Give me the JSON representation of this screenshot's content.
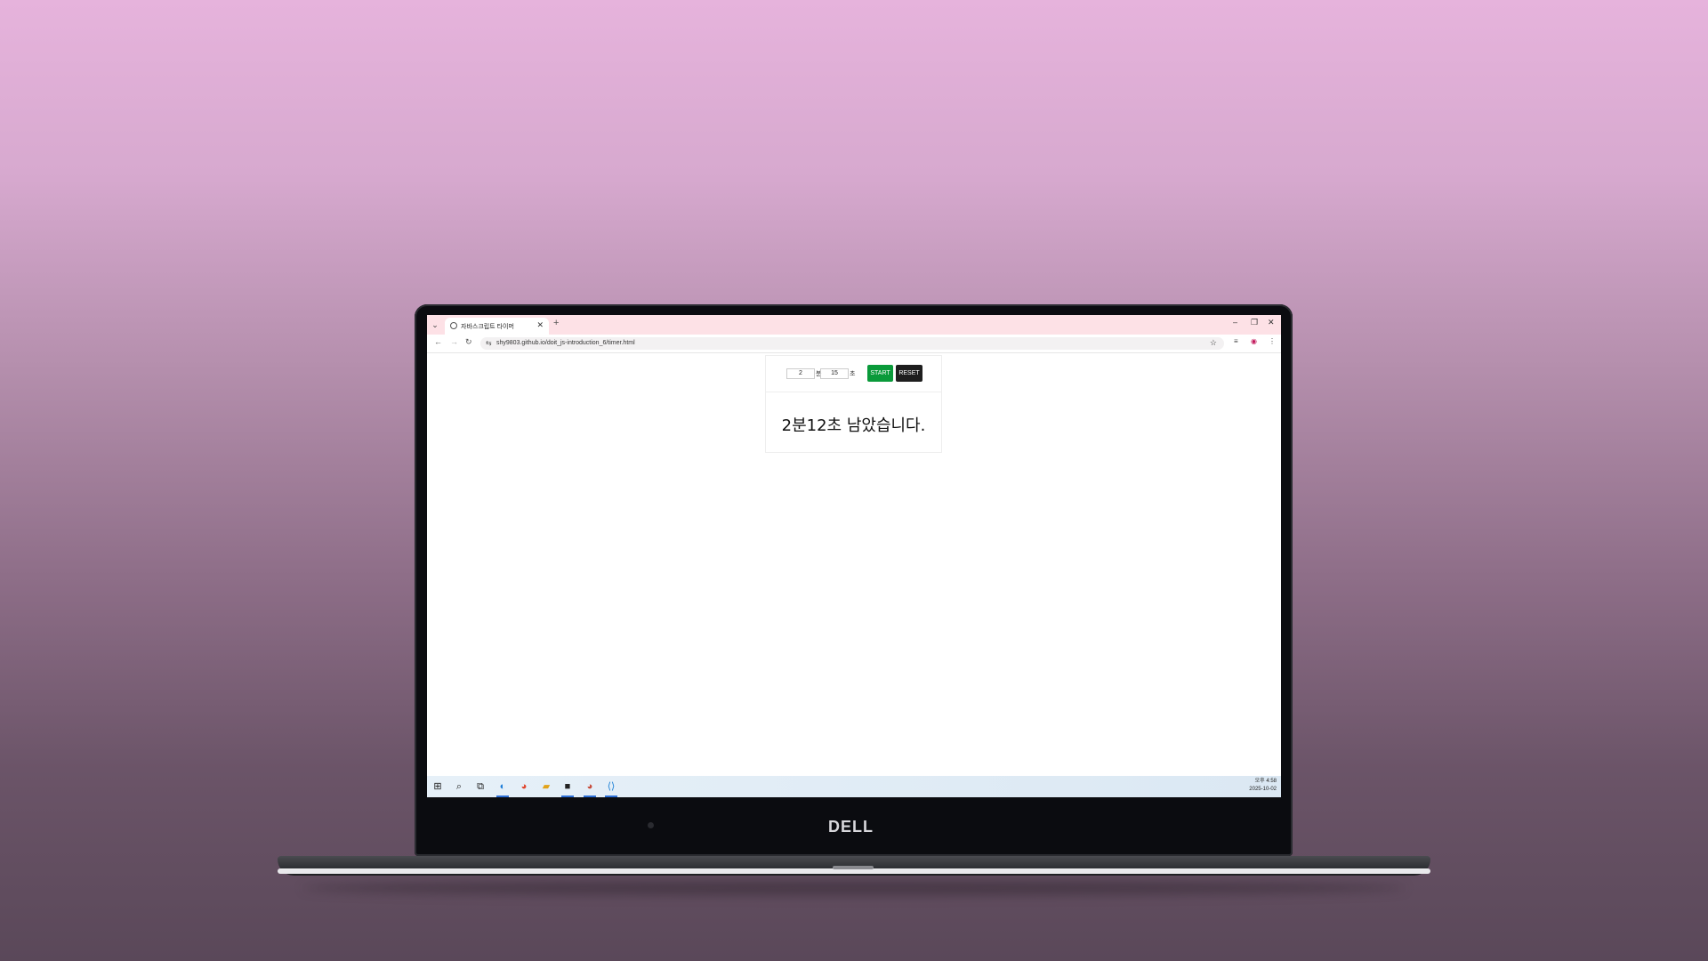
{
  "browser": {
    "tab_title": "자바스크립트 타이머",
    "new_tab": "+",
    "url": "shy9803.github.io/doit_js-introduction_6/timer.html",
    "controls": {
      "minimize": "–",
      "restore": "❐",
      "close": "✕"
    }
  },
  "timer": {
    "minutes_value": "2",
    "minutes_unit": "분",
    "seconds_value": "15",
    "seconds_unit": "초",
    "start_label": "START",
    "reset_label": "RESET",
    "remaining_text": "2분12초 남았습니다."
  },
  "taskbar": {
    "time": "오후 4:58",
    "date": "2025-10-02"
  },
  "device": {
    "brand": "DELL"
  },
  "colors": {
    "tabbar_bg": "#fde1e6",
    "start_button": "#0a9a3a",
    "reset_button": "#1e1e1e"
  },
  "icons": [
    "tab-dropdown-icon",
    "globe-icon",
    "close-icon",
    "back-icon",
    "forward-icon",
    "reload-icon",
    "site-info-icon",
    "star-icon",
    "extension-icon",
    "profile-icon",
    "menu-icon",
    "windows-start-icon",
    "search-icon",
    "task-view-icon",
    "edge-icon",
    "chrome-icon",
    "file-explorer-icon",
    "sticky-app-icon",
    "chrome-profile-icon",
    "vscode-icon"
  ]
}
